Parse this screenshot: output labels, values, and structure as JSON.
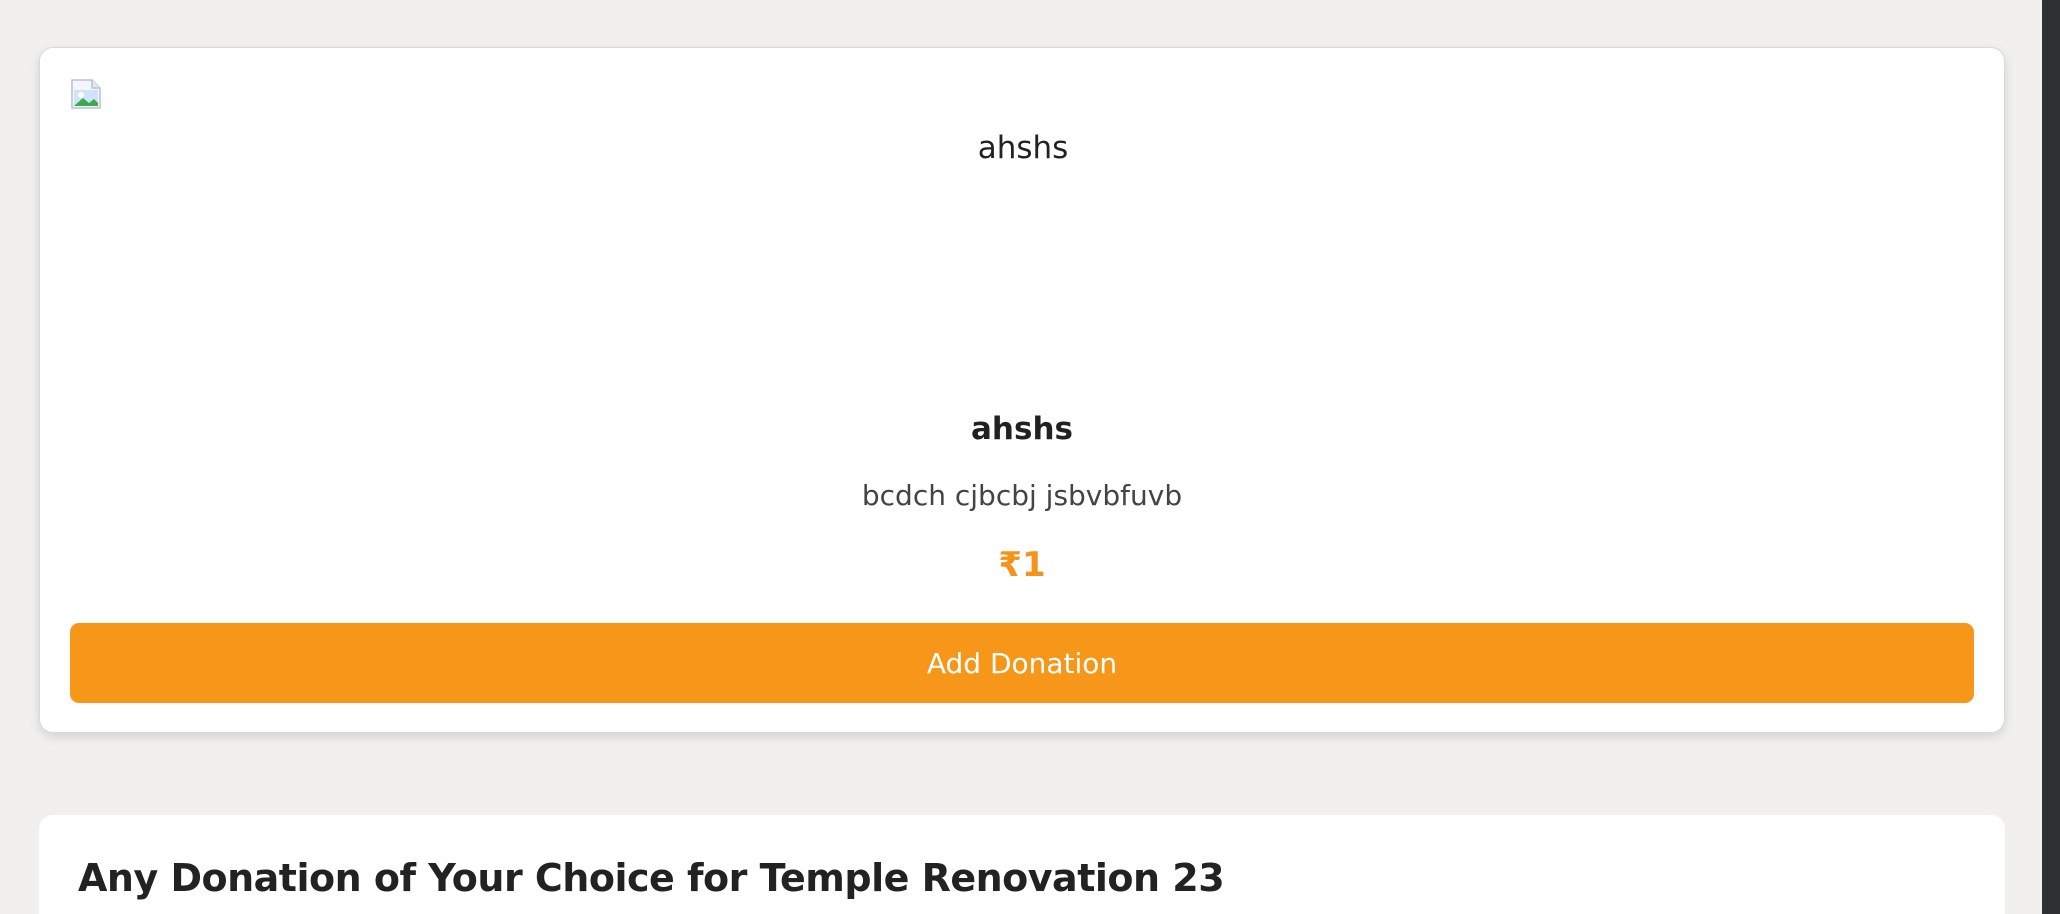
{
  "donation_card": {
    "image_alt": "ahshs",
    "title": "ahshs",
    "description": "bcdch cjbcbj jsbvbfuvb",
    "price": "₹1",
    "button_label": "Add Donation"
  },
  "next_card": {
    "title": "Any Donation of Your Choice for Temple Renovation 23"
  },
  "colors": {
    "accent": "#f7971a",
    "price": "#f7931a",
    "background": "#f1f0ee"
  },
  "icons": {
    "broken_image": "broken-image-icon"
  }
}
